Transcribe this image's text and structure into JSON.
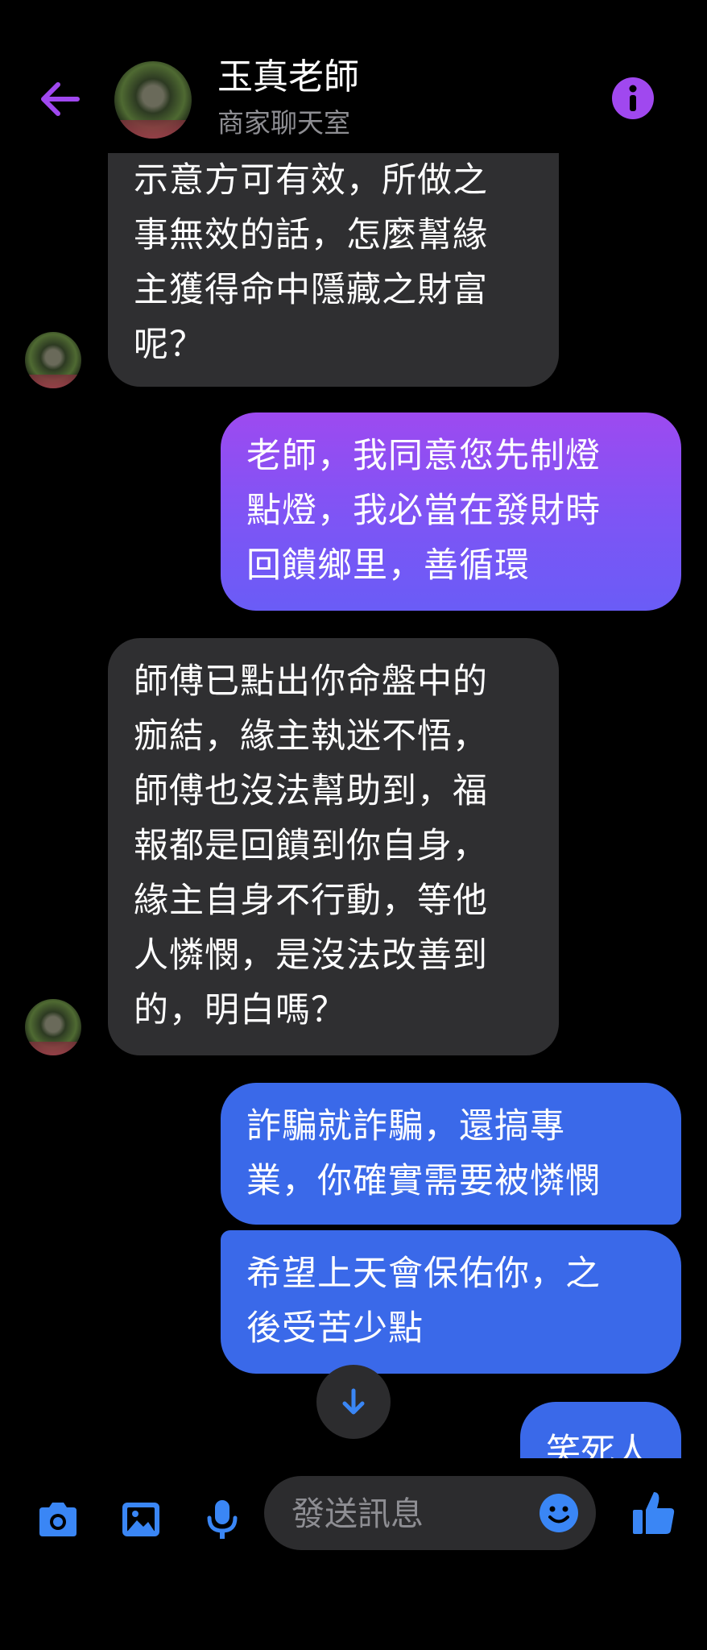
{
  "header": {
    "contact_name": "玉真老師",
    "contact_subtitle": "商家聊天室"
  },
  "messages": [
    {
      "direction": "incoming",
      "text": "示意方可有效，所做之\n事無效的話，怎麼幫緣\n主獲得命中隱藏之財富\n呢？"
    },
    {
      "direction": "outgoing",
      "color": "#8b50f2",
      "text": "老師，我同意您先制燈\n點燈，我必當在發財時\n回饋鄉里，善循環"
    },
    {
      "direction": "incoming",
      "text": "師傅已點出你命盤中的\n痂結，緣主執迷不悟，\n師傅也沒法幫助到，福\n報都是回饋到你自身，\n緣主自身不行動，等他\n人憐憫，是沒法改善到\n的，明白嗎？"
    },
    {
      "direction": "outgoing",
      "color": "#3a69e9",
      "text": "詐騙就詐騙，還搞專\n業，你確實需要被憐憫"
    },
    {
      "direction": "outgoing",
      "color": "#3a69e9",
      "text": "希望上天會保佑你，之\n後受苦少點"
    },
    {
      "direction": "outgoing",
      "color": "#3a69e9",
      "text": "笑死人"
    }
  ],
  "composer": {
    "placeholder": "發送訊息"
  },
  "icons": {
    "accent": "#a048ef",
    "composer": "#3a86f5"
  }
}
